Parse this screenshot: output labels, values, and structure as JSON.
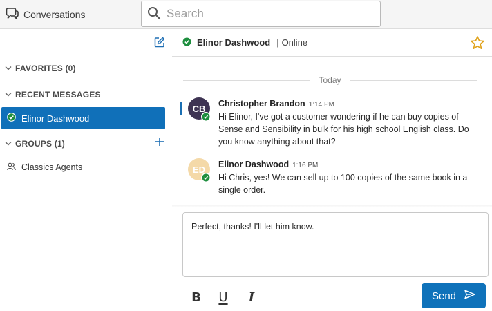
{
  "app": {
    "title": "Conversations"
  },
  "search": {
    "placeholder": "Search"
  },
  "sidebar": {
    "favorites_label": "FAVORITES (0)",
    "recent_label": "RECENT MESSAGES",
    "recent_items": [
      {
        "name": "Elinor Dashwood",
        "status": "online"
      }
    ],
    "groups_label": "GROUPS (1)",
    "groups": [
      {
        "name": "Classics Agents"
      }
    ]
  },
  "chat": {
    "contact_name": "Elinor Dashwood",
    "status_text": "Online",
    "separator": "|",
    "day_label": "Today",
    "messages": [
      {
        "initials": "CB",
        "author": "Christopher Brandon",
        "time": "1:14 PM",
        "text": "Hi Elinor, I've got a customer wondering if he can buy copies of Sense and Sensibility in bulk for his high school English class. Do you know anything about that?"
      },
      {
        "initials": "ED",
        "author": "Elinor Dashwood",
        "time": "1:16 PM",
        "text": "Hi Chris, yes! We can sell up to 100 copies of the same book in a single order."
      }
    ]
  },
  "composer": {
    "value": "Perfect, thanks! I'll let him know.",
    "bold_label": "B",
    "underline_label": "U",
    "italic_label": "I",
    "send_label": "Send"
  },
  "colors": {
    "accent": "#0f72ba",
    "online": "#1e8e3e",
    "star": "#e0a21b"
  }
}
